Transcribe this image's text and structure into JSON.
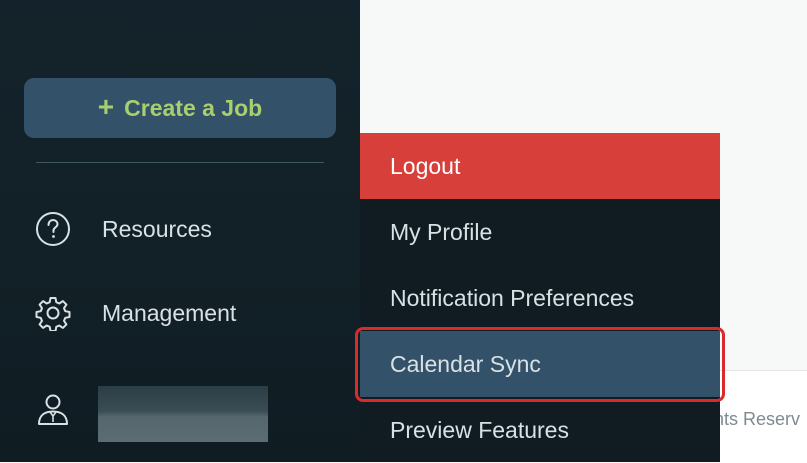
{
  "sidebar": {
    "create_job": {
      "icon": "plus-icon",
      "label": "Create a Job"
    },
    "items": [
      {
        "icon": "help-circle-icon",
        "label": "Resources"
      },
      {
        "icon": "gear-icon",
        "label": "Management"
      }
    ],
    "user": {
      "icon": "user-icon"
    }
  },
  "dropdown": {
    "items": [
      {
        "label": "Logout"
      },
      {
        "label": "My Profile"
      },
      {
        "label": "Notification Preferences"
      },
      {
        "label": "Calendar Sync"
      },
      {
        "label": "Preview Features"
      }
    ]
  },
  "footer": {
    "text": "hts Reserv"
  },
  "colors": {
    "sidebar_bg": "#14232b",
    "accent_green": "#a8cf6e",
    "logout_red": "#d63f3a",
    "selected_bg": "#34516a",
    "highlight_border": "#d92b2b"
  }
}
